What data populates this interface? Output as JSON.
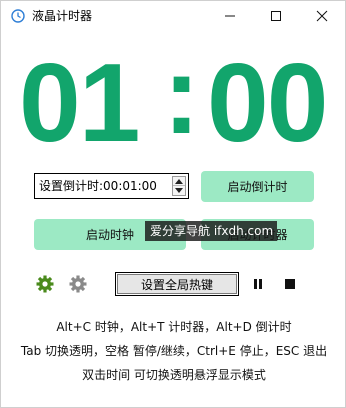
{
  "window": {
    "title": "液晶计时器",
    "icons": {
      "app": "clock-app-icon",
      "minimize": "minimize-icon",
      "maximize": "maximize-icon",
      "close": "close-icon"
    }
  },
  "clock": {
    "hours": "01",
    "separator": ":",
    "minutes": "00",
    "color": "#12a56c"
  },
  "countdown": {
    "value": "设置倒计时:00:01:00"
  },
  "buttons": {
    "start_countdown": "启动倒计时",
    "start_clock": "启动时钟",
    "start_timer": "启动计时器",
    "hotkey": "设置全局热键"
  },
  "watermark": {
    "text": "爱分享导航 ifxdh.com"
  },
  "controls": {
    "settings_green": "gear-icon",
    "settings_gray": "gear-icon",
    "pause": "pause-icon",
    "stop": "stop-icon"
  },
  "help": {
    "line1": "Alt+C 时钟，Alt+T 计时器，Alt+D 倒计时",
    "line2": "Tab 切换透明，空格 暂停/继续，Ctrl+E 停止，ESC 退出",
    "line3": "双击时间 可切换透明悬浮显示模式"
  },
  "colors": {
    "button_green": "#9ce9c4",
    "digit_green": "#12a56c",
    "gear_green": "#4a8a1c"
  }
}
